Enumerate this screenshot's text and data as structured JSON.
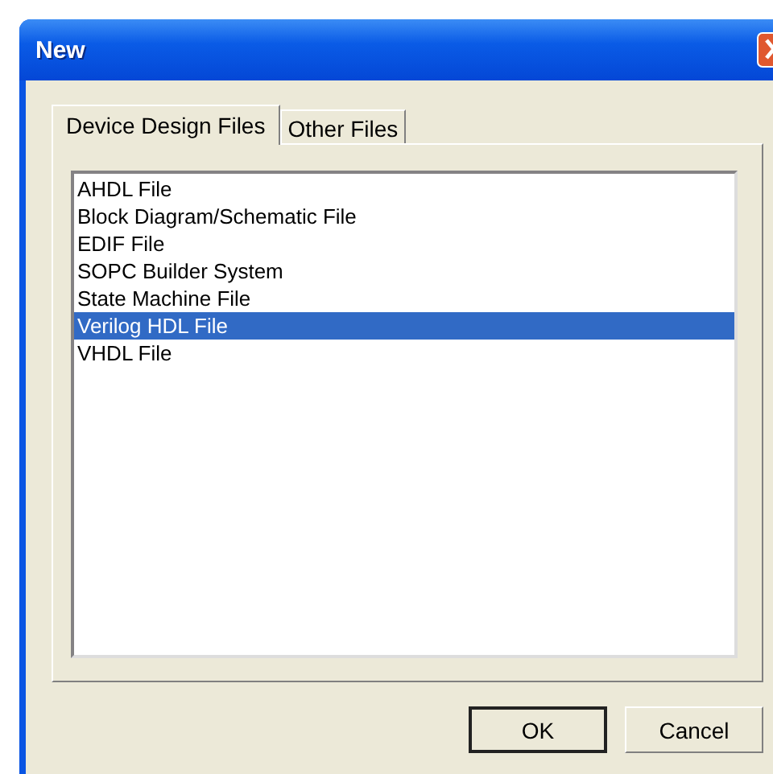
{
  "window": {
    "title": "New"
  },
  "tabs": [
    {
      "label": "Device Design Files",
      "selected": true
    },
    {
      "label": "Other Files",
      "selected": false
    }
  ],
  "list": {
    "items": [
      {
        "label": "AHDL File",
        "selected": false
      },
      {
        "label": "Block Diagram/Schematic File",
        "selected": false
      },
      {
        "label": "EDIF File",
        "selected": false
      },
      {
        "label": "SOPC Builder System",
        "selected": false
      },
      {
        "label": "State Machine File",
        "selected": false
      },
      {
        "label": "Verilog HDL File",
        "selected": true
      },
      {
        "label": "VHDL File",
        "selected": false
      }
    ]
  },
  "buttons": [
    {
      "label": "OK",
      "default": true
    },
    {
      "label": "Cancel",
      "default": false
    }
  ]
}
